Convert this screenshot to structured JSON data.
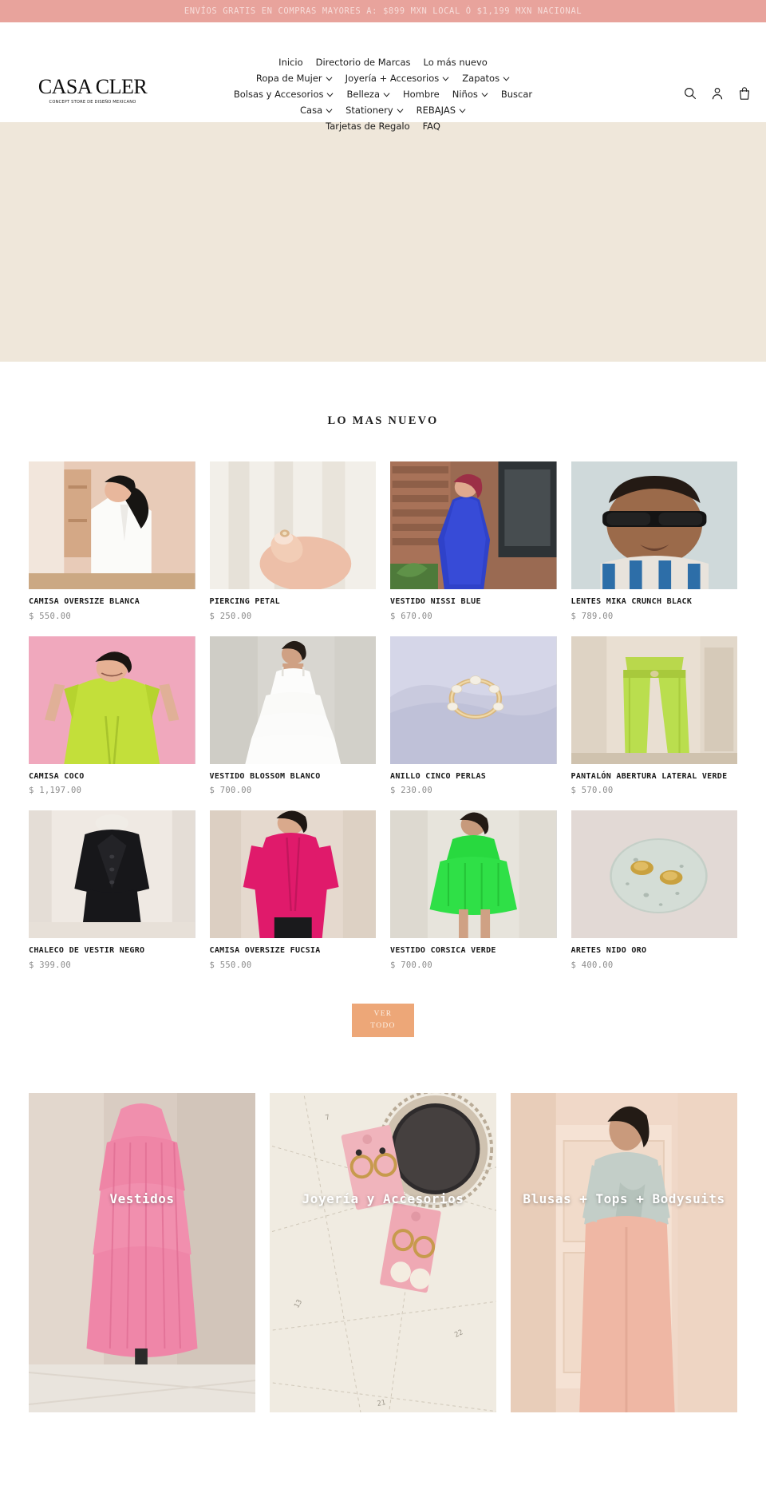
{
  "announcement": {
    "text": "ENVÍOS GRATIS EN COMPRAS MAYORES A: $899 MXN LOCAL Ó $1,199 MXN NACIONAL",
    "bg_color": "#e8a39c",
    "text_color": "#f7ddda"
  },
  "brand": {
    "name": "CASA CLER",
    "tagline": "CONCEPT STORE DE DISEÑO MEXICANO"
  },
  "nav": {
    "rows": [
      [
        {
          "label": "Inicio",
          "has_caret": false
        },
        {
          "label": "Directorio de Marcas",
          "has_caret": false
        },
        {
          "label": "Lo más nuevo",
          "has_caret": false
        }
      ],
      [
        {
          "label": "Ropa de Mujer",
          "has_caret": true
        },
        {
          "label": "Joyería + Accesorios",
          "has_caret": true
        },
        {
          "label": "Zapatos",
          "has_caret": true
        }
      ],
      [
        {
          "label": "Bolsas y Accesorios",
          "has_caret": true
        },
        {
          "label": "Belleza",
          "has_caret": true
        },
        {
          "label": "Hombre",
          "has_caret": false
        },
        {
          "label": "Niños",
          "has_caret": true
        },
        {
          "label": "Buscar",
          "has_caret": false
        }
      ],
      [
        {
          "label": "Casa",
          "has_caret": true
        },
        {
          "label": "Stationery",
          "has_caret": true
        },
        {
          "label": "REBAJAS",
          "has_caret": true
        }
      ],
      [
        {
          "label": "Tarjetas de Regalo",
          "has_caret": false
        },
        {
          "label": "FAQ",
          "has_caret": false
        }
      ]
    ],
    "icons": [
      "search-icon",
      "account-icon",
      "cart-icon"
    ]
  },
  "hero": {
    "bg_color": "#efe7da"
  },
  "new_arrivals": {
    "title": "LO MAS NUEVO",
    "view_all_line1": "VER",
    "view_all_line2": "TODO",
    "view_all_color": "#eda778",
    "products": [
      {
        "name": "CAMISA OVERSIZE BLANCA",
        "price": "$ 550.00"
      },
      {
        "name": "PIERCING PETAL",
        "price": "$ 250.00"
      },
      {
        "name": "VESTIDO NISSI BLUE",
        "price": "$ 670.00"
      },
      {
        "name": "LENTES MIKA CRUNCH BLACK",
        "price": "$ 789.00"
      },
      {
        "name": "CAMISA COCO",
        "price": "$ 1,197.00"
      },
      {
        "name": "VESTIDO BLOSSOM BLANCO",
        "price": "$ 700.00"
      },
      {
        "name": "ANILLO CINCO PERLAS",
        "price": "$ 230.00"
      },
      {
        "name": "PANTALÓN ABERTURA LATERAL VERDE",
        "price": "$ 570.00"
      },
      {
        "name": "CHALECO DE VESTIR NEGRO",
        "price": "$ 399.00"
      },
      {
        "name": "CAMISA OVERSIZE FUCSIA",
        "price": "$ 550.00"
      },
      {
        "name": "VESTIDO CORSICA VERDE",
        "price": "$ 700.00"
      },
      {
        "name": "ARETES NIDO ORO",
        "price": "$ 400.00"
      }
    ]
  },
  "categories": [
    {
      "label": "Vestidos"
    },
    {
      "label": "Joyería y Accesorios"
    },
    {
      "label": "Blusas + Tops + Bodysuits"
    }
  ]
}
